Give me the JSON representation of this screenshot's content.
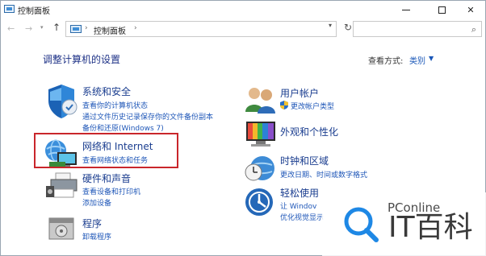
{
  "window": {
    "title": "控制面板"
  },
  "address_bar": {
    "separator": "›",
    "crumb": "控制面板",
    "crumb_separator": "›"
  },
  "page": {
    "title": "调整计算机的设置",
    "view_by_label": "查看方式:",
    "view_by_value": "类别"
  },
  "categories_left": [
    {
      "icon": "shield-icon",
      "title": "系统和安全",
      "links": [
        "查看你的计算机状态",
        "通过文件历史记录保存你的文件备份副本",
        "备份和还原(Windows 7)"
      ]
    },
    {
      "icon": "network-icon",
      "title": "网络和 Internet",
      "links": [
        "查看网络状态和任务"
      ]
    },
    {
      "icon": "printer-icon",
      "title": "硬件和声音",
      "links": [
        "查看设备和打印机",
        "添加设备"
      ]
    },
    {
      "icon": "programs-icon",
      "title": "程序",
      "links": [
        "卸载程序"
      ]
    }
  ],
  "categories_right": [
    {
      "icon": "users-icon",
      "title": "用户帐户",
      "links": [
        "更改帐户类型"
      ]
    },
    {
      "icon": "appearance-icon",
      "title": "外观和个性化",
      "links": []
    },
    {
      "icon": "clock-globe-icon",
      "title": "时钟和区域",
      "links": [
        "更改日期、时间或数字格式"
      ]
    },
    {
      "icon": "ease-of-access-icon",
      "title": "轻松使用",
      "links": [
        "让 Windov",
        "优化视觉显示"
      ]
    }
  ],
  "watermark": {
    "small_text": "PConline",
    "brand_text": "IT百科"
  },
  "colors": {
    "highlight_border": "#c9262b",
    "link": "#1f57b8",
    "category_title": "#1a3d8f"
  }
}
